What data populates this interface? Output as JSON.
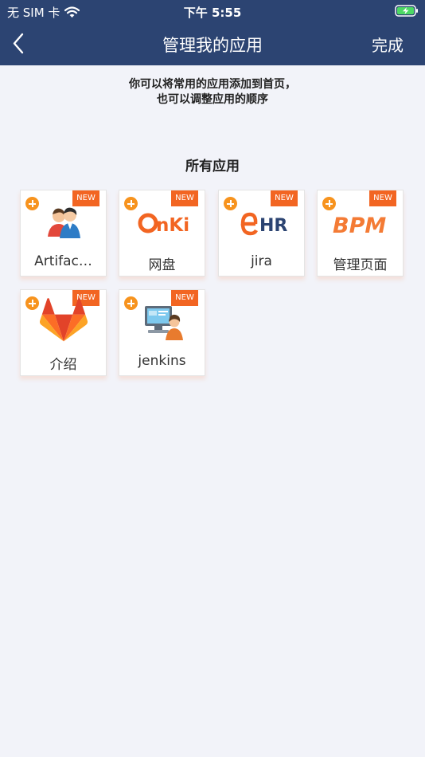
{
  "status": {
    "carrier": "无 SIM 卡",
    "time": "下午 5:55"
  },
  "nav": {
    "title": "管理我的应用",
    "done_label": "完成"
  },
  "hint": {
    "line1": "你可以将常用的应用添加到首页，",
    "line2": "也可以调整应用的顺序"
  },
  "section": {
    "title": "所有应用"
  },
  "apps": [
    {
      "label": "Artifac…",
      "badge": "NEW",
      "icon": "people-icon"
    },
    {
      "label": "网盘",
      "badge": "NEW",
      "icon": "onki-logo-icon",
      "logo_text": "nKi"
    },
    {
      "label": "jira",
      "badge": "NEW",
      "icon": "ehr-logo-icon",
      "logo_text": "HR"
    },
    {
      "label": "管理页面",
      "badge": "NEW",
      "icon": "bpm-logo-icon",
      "logo_text": "BPM"
    },
    {
      "label": "介绍",
      "badge": "NEW",
      "icon": "gitlab-fox-icon"
    },
    {
      "label": "jenkins",
      "badge": "NEW",
      "icon": "computer-user-icon"
    }
  ],
  "colors": {
    "header": "#2c4472",
    "accent": "#f7931e",
    "badge": "#f26522",
    "background": "#f2f3f9"
  }
}
